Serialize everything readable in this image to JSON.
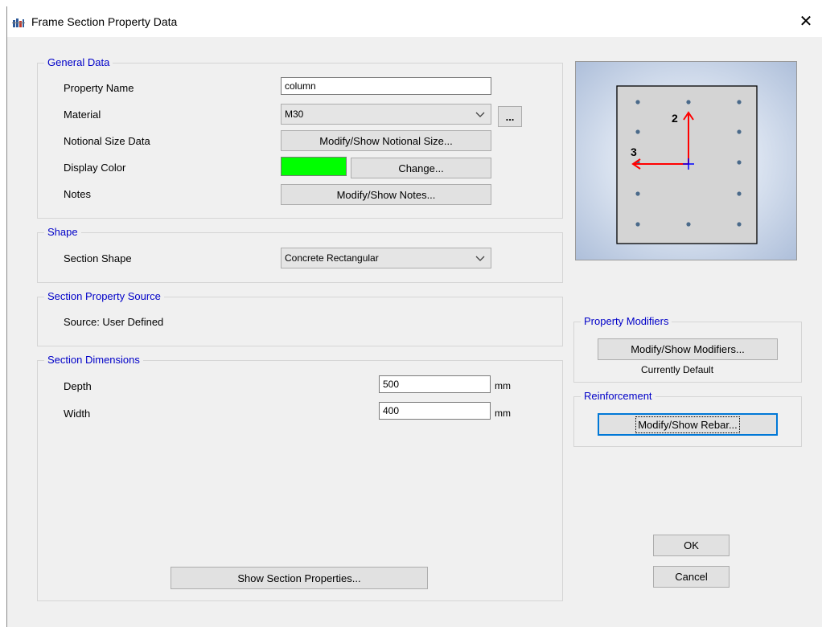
{
  "window": {
    "title": "Frame Section Property Data",
    "close_glyph": "✕"
  },
  "general": {
    "legend": "General Data",
    "property_name_label": "Property Name",
    "property_name_value": "column",
    "material_label": "Material",
    "material_value": "M30",
    "material_more_button": "...",
    "notional_label": "Notional Size Data",
    "notional_button": "Modify/Show Notional Size...",
    "display_color_label": "Display Color",
    "display_color_hex": "#00ff00",
    "change_button": "Change...",
    "notes_label": "Notes",
    "notes_button": "Modify/Show Notes..."
  },
  "shape": {
    "legend": "Shape",
    "section_shape_label": "Section Shape",
    "section_shape_value": "Concrete Rectangular"
  },
  "source": {
    "legend": "Section Property Source",
    "text": "Source:  User Defined"
  },
  "dimensions": {
    "legend": "Section Dimensions",
    "depth_label": "Depth",
    "depth_value": "500",
    "depth_unit": "mm",
    "width_label": "Width",
    "width_value": "400",
    "width_unit": "mm",
    "show_properties_button": "Show Section Properties..."
  },
  "preview": {
    "axis_2_label": "2",
    "axis_3_label": "3"
  },
  "modifiers": {
    "legend": "Property Modifiers",
    "button": "Modify/Show Modifiers...",
    "status": "Currently Default"
  },
  "reinforcement": {
    "legend": "Reinforcement",
    "button": "Modify/Show Rebar..."
  },
  "actions": {
    "ok": "OK",
    "cancel": "Cancel"
  },
  "icons": [
    "app-icon",
    "close-icon",
    "chevron-down-icon"
  ],
  "colors": {
    "legend": "#0000c8",
    "focus": "#0078d7",
    "axis": "#ff0000",
    "rebar": "#4a6a8a"
  }
}
